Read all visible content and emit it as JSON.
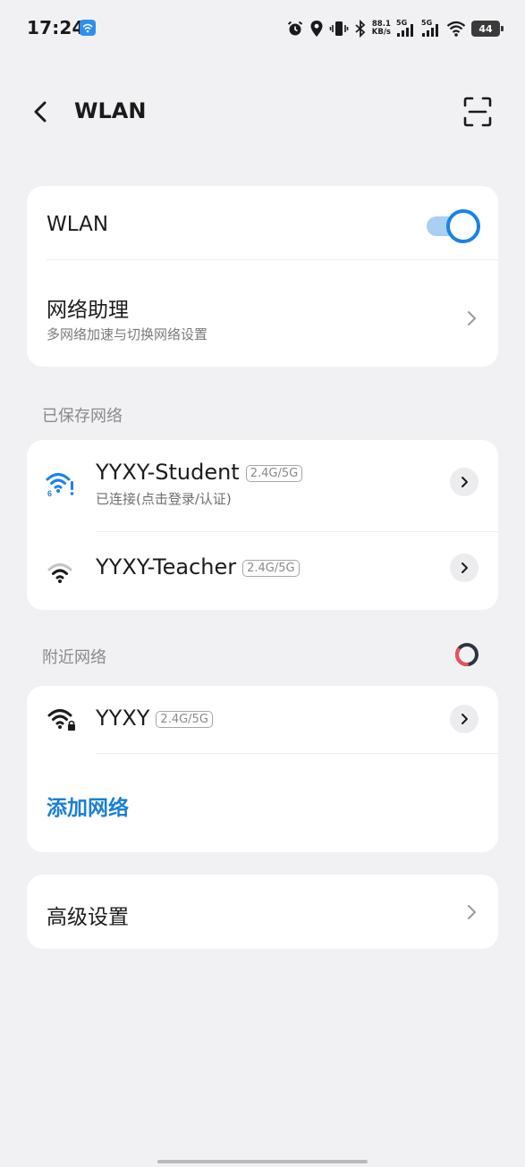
{
  "status_bar": {
    "time": "17:24",
    "net_speed_value": "88.1",
    "net_speed_unit": "KB/s",
    "sim1_label": "5G",
    "sim2_label": "5G",
    "battery": "44"
  },
  "header": {
    "title": "WLAN"
  },
  "wlan_card": {
    "toggle_label": "WLAN",
    "toggle_on": true,
    "assistant_title": "网络助理",
    "assistant_subtitle": "多网络加速与切换网络设置"
  },
  "saved_networks": {
    "label": "已保存网络",
    "items": [
      {
        "name": "YYXY-Student",
        "band": "2.4G/5G",
        "status": "已连接(点击登录/认证)",
        "wifi_badge": "6"
      },
      {
        "name": "YYXY-Teacher",
        "band": "2.4G/5G"
      }
    ]
  },
  "nearby_networks": {
    "label": "附近网络",
    "items": [
      {
        "name": "YYXY",
        "band": "2.4G/5G"
      }
    ],
    "add_label": "添加网络"
  },
  "advanced": {
    "label": "高级设置"
  },
  "colors": {
    "accent": "#1a82e6",
    "background": "#f1f1f3",
    "card": "#ffffff"
  }
}
